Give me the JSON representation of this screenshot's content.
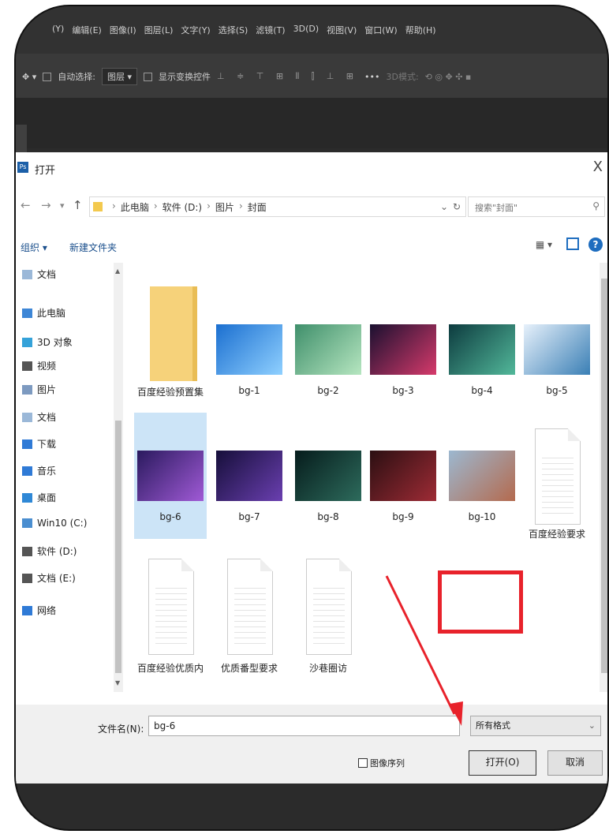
{
  "ps_menu": [
    "(Y)",
    "编辑(E)",
    "图像(I)",
    "图层(L)",
    "文字(Y)",
    "选择(S)",
    "滤镜(T)",
    "3D(D)",
    "视图(V)",
    "窗口(W)",
    "帮助(H)"
  ],
  "ps_options": {
    "auto_select": "自动选择:",
    "layer_dd": "图层",
    "show_transform": "显示变换控件",
    "more": "•••",
    "mode_3d": "3D模式:"
  },
  "dialog": {
    "title": "打开",
    "close": "X",
    "path": [
      "此电脑",
      "软件 (D:)",
      "图片",
      "封面"
    ],
    "search_placeholder": "搜索\"封面\"",
    "organize": "组织 ▾",
    "new_folder": "新建文件夹"
  },
  "sidebar": [
    {
      "label": "文档",
      "icon": "document-icon",
      "color": "#9bb8d8"
    },
    {
      "label": "此电脑",
      "icon": "computer-icon",
      "color": "#3d86d6"
    },
    {
      "label": "3D 对象",
      "icon": "cube-icon",
      "color": "#35a2d9"
    },
    {
      "label": "视频",
      "icon": "video-icon",
      "color": "#555555"
    },
    {
      "label": "图片",
      "icon": "pictures-icon",
      "color": "#7d9ac0"
    },
    {
      "label": "文档",
      "icon": "document-icon",
      "color": "#9bb8d8"
    },
    {
      "label": "下载",
      "icon": "download-icon",
      "color": "#2f7ad6"
    },
    {
      "label": "音乐",
      "icon": "music-icon",
      "color": "#2f7ad6"
    },
    {
      "label": "桌面",
      "icon": "desktop-icon",
      "color": "#2f88d6"
    },
    {
      "label": "Win10 (C:)",
      "icon": "drive-icon",
      "color": "#4a8ed0"
    },
    {
      "label": "软件 (D:)",
      "icon": "drive-icon",
      "color": "#555555"
    },
    {
      "label": "文档 (E:)",
      "icon": "drive-icon",
      "color": "#555555"
    },
    {
      "label": "网络",
      "icon": "network-icon",
      "color": "#2f7ad6"
    }
  ],
  "files": [
    {
      "label": "百度经验预置集",
      "kind": "folder"
    },
    {
      "label": "bg-1",
      "kind": "image",
      "colors": [
        "#1b6fd0",
        "#8fd0ff"
      ]
    },
    {
      "label": "bg-2",
      "kind": "image",
      "colors": [
        "#3f8f6b",
        "#b6e6c0"
      ]
    },
    {
      "label": "bg-3",
      "kind": "image",
      "colors": [
        "#1a1030",
        "#d63a6b"
      ]
    },
    {
      "label": "bg-4",
      "kind": "image",
      "colors": [
        "#0d3b3f",
        "#52b89a"
      ]
    },
    {
      "label": "bg-5",
      "kind": "image",
      "colors": [
        "#e7f1fb",
        "#3a7fb5"
      ]
    },
    {
      "label": "bg-6",
      "kind": "image",
      "colors": [
        "#2a1a5e",
        "#a05ad6"
      ],
      "selected": true
    },
    {
      "label": "bg-7",
      "kind": "image",
      "colors": [
        "#160f3a",
        "#6a3fb0"
      ]
    },
    {
      "label": "bg-8",
      "kind": "image",
      "colors": [
        "#061c1c",
        "#2d6b5c"
      ]
    },
    {
      "label": "bg-9",
      "kind": "image",
      "colors": [
        "#2b0f12",
        "#9e2b35"
      ]
    },
    {
      "label": "bg-10",
      "kind": "image",
      "colors": [
        "#9cb8d0",
        "#b46a4e"
      ]
    },
    {
      "label": "百度经验要求",
      "kind": "doc"
    },
    {
      "label": "百度经验优质内",
      "kind": "doc"
    },
    {
      "label": "优质番型要求",
      "kind": "doc"
    },
    {
      "label": "沙巷圈访",
      "kind": "doc"
    }
  ],
  "bottom": {
    "filename_label": "文件名(N):",
    "filename_value": "bg-6",
    "filetype": "所有格式",
    "image_sequence": "图像序列",
    "open_button": "打开(O)",
    "cancel_button": "取消"
  },
  "colors": {
    "highlight": "#e8222b",
    "accent": "#1e6dbf"
  }
}
